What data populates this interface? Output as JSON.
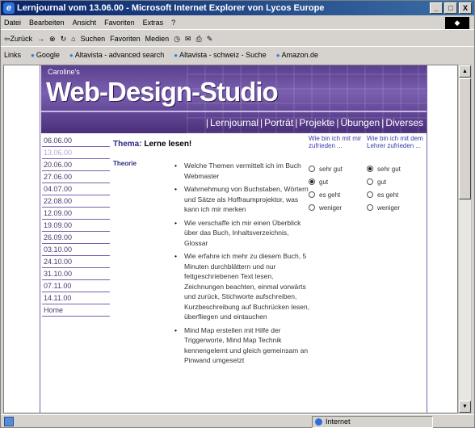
{
  "window": {
    "title": "Lernjournal vom 13.06.00 - Microsoft Internet Explorer von Lycos Europe",
    "controls": [
      "_",
      "□",
      "X"
    ]
  },
  "menubar": {
    "items": [
      "Datei",
      "Bearbeiten",
      "Ansicht",
      "Favoriten",
      "Extras",
      "?"
    ]
  },
  "toolbar": {
    "back_label": "⇦Zurück",
    "forward_label": "→",
    "search_label": "Suchen",
    "favorites_label": "Favoriten",
    "media_label": "Medien"
  },
  "linksbar": {
    "label": "Links",
    "items": [
      "Google",
      "Altavista - advanced search",
      "Altavista - schweiz - Suche",
      "Amazon.de"
    ]
  },
  "banner": {
    "small_text": "Caroline's",
    "title": "Web-Design-Studio"
  },
  "nav": {
    "items": [
      "Lernjournal",
      "Porträt",
      "Projekte",
      "Übungen",
      "Diverses"
    ]
  },
  "dates": {
    "items": [
      "06.06.00",
      "13.06.00",
      "20.06.00",
      "27.06.00",
      "04.07.00",
      "22.08.00",
      "12.09.00",
      "19.09.00",
      "26.09.00",
      "03.10.00",
      "24.10.00",
      "31.10.00",
      "07.11.00",
      "14.11.00",
      "Home"
    ]
  },
  "theme": {
    "label": "Thema:",
    "value": "Lerne lesen!"
  },
  "section": {
    "label": "Theorie"
  },
  "bullets": {
    "items": [
      "Welche Themen vermittelt ich im Buch Webmaster",
      "Wahrnehmung von Buchstaben, Wörtern und Sätze als Hoffraumprojektor, was kann ich mir merken",
      "Wie verschaffe ich mir einen Überblick über das Buch, Inhaltsverzeichnis, Glossar",
      "Wie erfahre ich mehr zu diesem Buch, 5 Minuten durchblättern und nur fettgeschriebenen Text lesen, Zeichnungen beachten, einmal vorwärts und zurück, Stichworte aufschreiben, Kurzbeschreibung auf Buchrücken lesen, überfliegen und eintauchen",
      "Mind Map erstellen mit Hilfe der Triggerworte, Mind Map Technik kennengelernt und gleich gemeinsam an Pinwand umgesetzt"
    ]
  },
  "survey1": {
    "question": "Wie bin ich mit mir zufrieden ...",
    "options": [
      "sehr gut",
      "gut",
      "es geht",
      "weniger"
    ],
    "selected": 1
  },
  "survey2": {
    "question": "Wie bin ich mit dem Lehrer zufrieden ...",
    "options": [
      "sehr gut",
      "gut",
      "es geht",
      "weniger"
    ],
    "selected": 0
  },
  "statusbar": {
    "zone": "Internet"
  }
}
